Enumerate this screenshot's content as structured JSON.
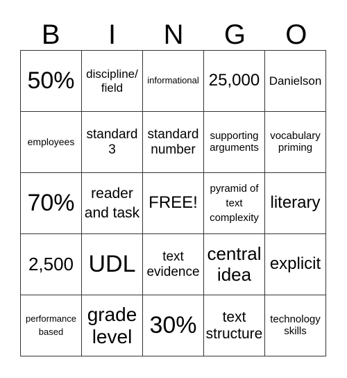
{
  "header": [
    "B",
    "I",
    "N",
    "G",
    "O"
  ],
  "rows": [
    [
      "50%",
      "discipline/ field",
      "informational",
      "25,000",
      "Danielson"
    ],
    [
      "employees",
      "standard 3",
      "standard number",
      "supporting arguments",
      "vocabulary priming"
    ],
    [
      "70%",
      "reader and task",
      "FREE!",
      "pyramid of text complexity",
      "literary"
    ],
    [
      "2,500",
      "UDL",
      "text evidence",
      "central idea",
      "explicit"
    ],
    [
      "performance based",
      "grade level",
      "30%",
      "text structure",
      "technology skills"
    ]
  ]
}
